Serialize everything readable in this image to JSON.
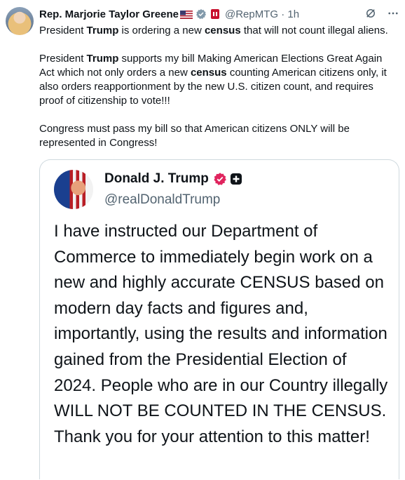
{
  "tweet": {
    "author_name": "Rep. Marjorie Taylor Greene",
    "handle": "@RepMTG",
    "separator": "·",
    "time": "1h",
    "icons": [
      "us-flag-icon",
      "verified-gray-icon",
      "government-badge-icon",
      "grok-icon",
      "more-dots-icon"
    ],
    "line1": {
      "a": "President ",
      "b": "Trump",
      "c": " is ordering a new ",
      "d": "census",
      "e": " that will not count illegal aliens."
    },
    "para2": {
      "a": "President ",
      "b": "Trump",
      "c": " supports my bill Making American Elections Great Again Act which not only orders a new ",
      "d": "census",
      "e": " counting American citizens only, it also orders reapportionment by the new U.S. citizen count, and requires proof of citizenship to vote!!!"
    },
    "para3": "Congress must pass my bill so that American citizens ONLY will be represented in Congress!"
  },
  "quote": {
    "author_name": "Donald J. Trump",
    "handle": "@realDonaldTrump",
    "icons": [
      "verified-pink-icon",
      "affiliate-plus-icon"
    ],
    "text": "I have instructed our Department of Commerce to immediately begin work on a new and highly accurate CENSUS based on modern day facts and figures and, importantly, using the results and information gained from the Presidential Election of 2024. People who are in our Country illegally WILL NOT BE COUNTED IN THE CENSUS. Thank you for your attention to this matter!"
  },
  "colors": {
    "text": "#0f1419",
    "secondary": "#536471",
    "border": "#cfd9de",
    "verified_pink": "#e0245e"
  }
}
